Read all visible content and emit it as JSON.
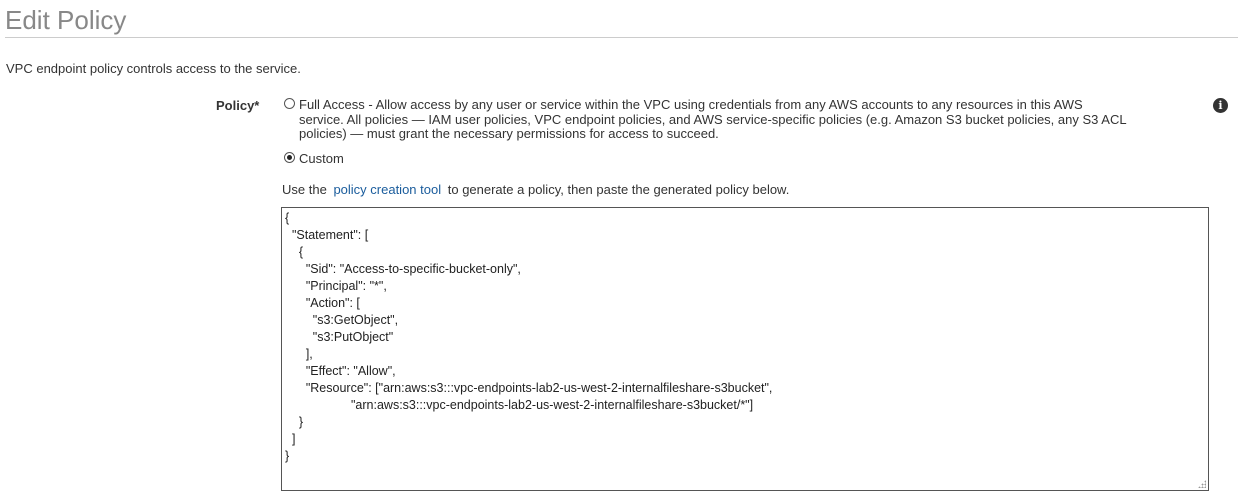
{
  "header": {
    "title": "Edit Policy"
  },
  "description": "VPC endpoint policy controls access to the service.",
  "policy": {
    "label": "Policy*",
    "options": [
      {
        "id": "full-access",
        "checked": false,
        "text_line1": "Full Access - Allow access by any user or service within the VPC using credentials from any AWS accounts to any resources in this AWS",
        "text_line2": "service. All policies — IAM user policies, VPC endpoint policies, and AWS service-specific policies (e.g. Amazon S3 bucket policies, any S3 ACL",
        "text_line3": "policies) — must grant the necessary permissions for access to succeed."
      },
      {
        "id": "custom",
        "checked": true,
        "text": "Custom"
      }
    ],
    "info_icon": "info-icon",
    "info_glyph": "i"
  },
  "helper": {
    "prefix": "Use the",
    "link": "policy creation tool",
    "suffix": "to generate a policy, then paste the generated policy below."
  },
  "editor": {
    "lines": [
      "{",
      "  \"Statement\": [",
      "    {",
      "      \"Sid\": \"Access-to-specific-bucket-only\",",
      "      \"Principal\": \"*\",",
      "      \"Action\": [",
      "        \"s3:GetObject\",",
      "        \"s3:PutObject\"",
      "      ],",
      "      \"Effect\": \"Allow\",",
      "      \"Resource\": [\"arn:aws:s3:::vpc-endpoints-lab2-us-west-2-internalfileshare-s3bucket\",",
      "                   \"arn:aws:s3:::vpc-endpoints-lab2-us-west-2-internalfileshare-s3bucket/*\"]",
      "    }",
      "  ]",
      "}"
    ]
  }
}
